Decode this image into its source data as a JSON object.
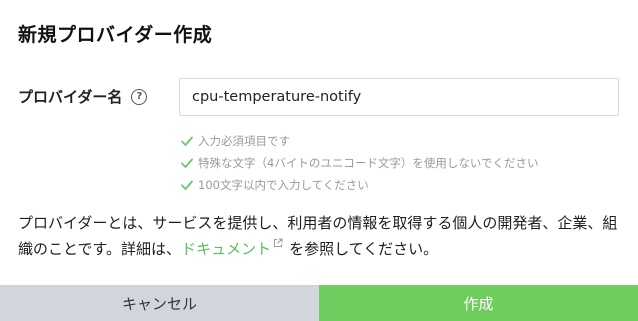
{
  "dialog": {
    "title": "新規プロバイダー作成"
  },
  "form": {
    "provider_name_label": "プロバイダー名",
    "help_icon_glyph": "?",
    "provider_name_value": "cpu-temperature-notify"
  },
  "hints": [
    {
      "text": "入力必須項目です",
      "icon": "check-icon",
      "color": "#6cc66c"
    },
    {
      "text": "特殊な文字（4バイトのユニコード文字）を使用しないでください",
      "icon": "check-icon",
      "color": "#6cc66c"
    },
    {
      "text": "100文字以内で入力してください",
      "icon": "check-icon",
      "color": "#6cc66c"
    }
  ],
  "description": {
    "text_before_link": "プロバイダーとは、サービスを提供し、利用者の情報を取得する個人の開発者、企業、組織のことです。詳細は、",
    "link_label": "ドキュメント",
    "text_after_link": "を参照してください。"
  },
  "footer": {
    "cancel_label": "キャンセル",
    "create_label": "作成"
  },
  "colors": {
    "accent_green": "#6fcd5e",
    "link_green": "#5bbf5b",
    "cancel_bg": "#d2d5dc",
    "hint_gray": "#9a9a9a"
  }
}
